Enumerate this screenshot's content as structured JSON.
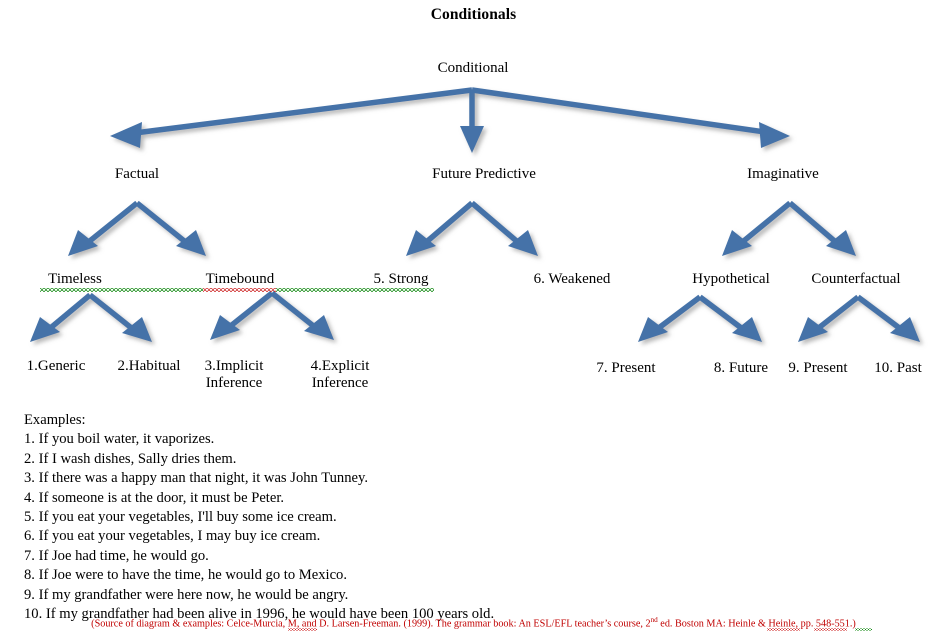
{
  "title": "Conditionals",
  "colors": {
    "arrow_blue": "#4472a8",
    "arrow_blue_dark": "#3a6596",
    "source_red": "#c00000",
    "spell_green": "#118811",
    "spell_red": "#cc2222",
    "text_black": "#000000",
    "background": "#ffffff"
  },
  "tree": {
    "root": {
      "label": "Conditional"
    },
    "level2": [
      {
        "label": "Factual"
      },
      {
        "label": "Future Predictive"
      },
      {
        "label": "Imaginative"
      }
    ],
    "level3": [
      {
        "label": "Timeless"
      },
      {
        "label": "Timebound"
      },
      {
        "label": "5. Strong"
      },
      {
        "label": "6. Weakened"
      },
      {
        "label": "Hypothetical"
      },
      {
        "label": "Counterfactual"
      }
    ],
    "level4": [
      {
        "label": "1.Generic"
      },
      {
        "label": "2.Habitual"
      },
      {
        "label": "3.Implicit Inference"
      },
      {
        "label": "4.Explicit Inference"
      },
      {
        "label": "7. Present"
      },
      {
        "label": "8. Future"
      },
      {
        "label": "9. Present"
      },
      {
        "label": "10. Past"
      }
    ]
  },
  "examples": {
    "heading": "Examples:",
    "items": [
      "1. If you boil water, it vaporizes.",
      "2. If I wash dishes, Sally dries them.",
      "3. If there was a happy man that night, it was John Tunney.",
      "4. If someone is at the door, it must be Peter.",
      "5. If you eat your vegetables, I'll buy some ice cream.",
      "6. If you eat your vegetables, I may buy ice cream.",
      "7. If Joe had time, he would go.",
      "8. If Joe were to have the time, he would go to Mexico.",
      "9. If my grandfather were here now, he would be angry.",
      "10. If my grandfather had been alive in 1996, he would have been 100 years old."
    ]
  },
  "source_note": {
    "part1": "(Source of diagram & examples: Celce-Murcia, M, and D. Larsen-Freeman. (1999).  The grammar book: An ESL/EFL teacher’s course, 2",
    "superscript": "nd",
    "part2": " ed. Boston MA: Heinle & Heinle,  pp. 548-551.)"
  }
}
